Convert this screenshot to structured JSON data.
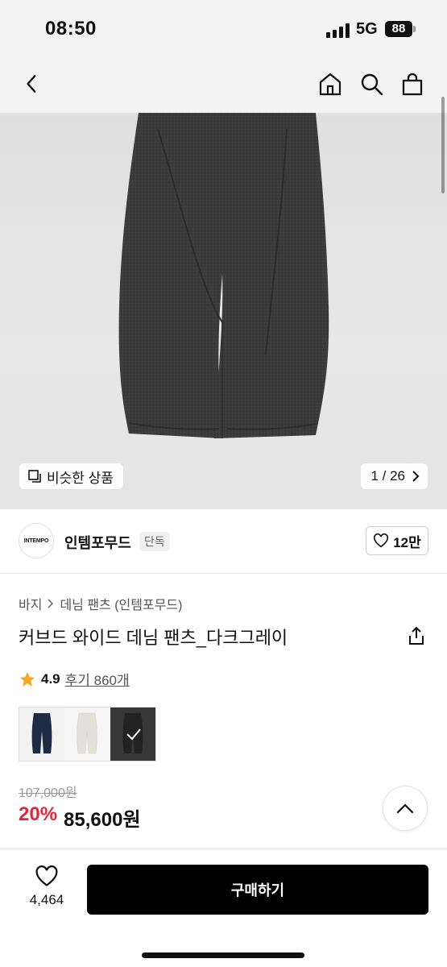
{
  "status_bar": {
    "time": "08:50",
    "network": "5G",
    "battery": "88"
  },
  "nav": {
    "back_icon": "chevron-left-icon",
    "home_icon": "home-icon",
    "search_icon": "search-icon",
    "cart_icon": "shopping-bag-icon"
  },
  "gallery": {
    "similar_label": "비슷한 상품",
    "page_indicator": "1 / 26"
  },
  "brand": {
    "logo_text": "INTEMPO",
    "name": "인템포무드",
    "badge": "단독",
    "likes": "12만"
  },
  "breadcrumb": {
    "category": "바지",
    "subcategory": "데님 팬츠 (인템포무드)"
  },
  "product": {
    "title": "커브드 와이드 데님 팬츠_다크그레이",
    "rating": "4.9",
    "reviews": "후기 860개",
    "original_price": "107,000원",
    "discount": "20%",
    "sale_price": "85,600원"
  },
  "swatches": [
    {
      "color": "#1f2a44",
      "selected": false
    },
    {
      "color": "#e5e3dc",
      "selected": false
    },
    {
      "color": "#2e2e2e",
      "selected": true
    }
  ],
  "bottom": {
    "wish_count": "4,464",
    "buy_label": "구매하기"
  },
  "colors": {
    "discount": "#e0263a",
    "star": "#f5a623",
    "buy_button": "#000000"
  }
}
